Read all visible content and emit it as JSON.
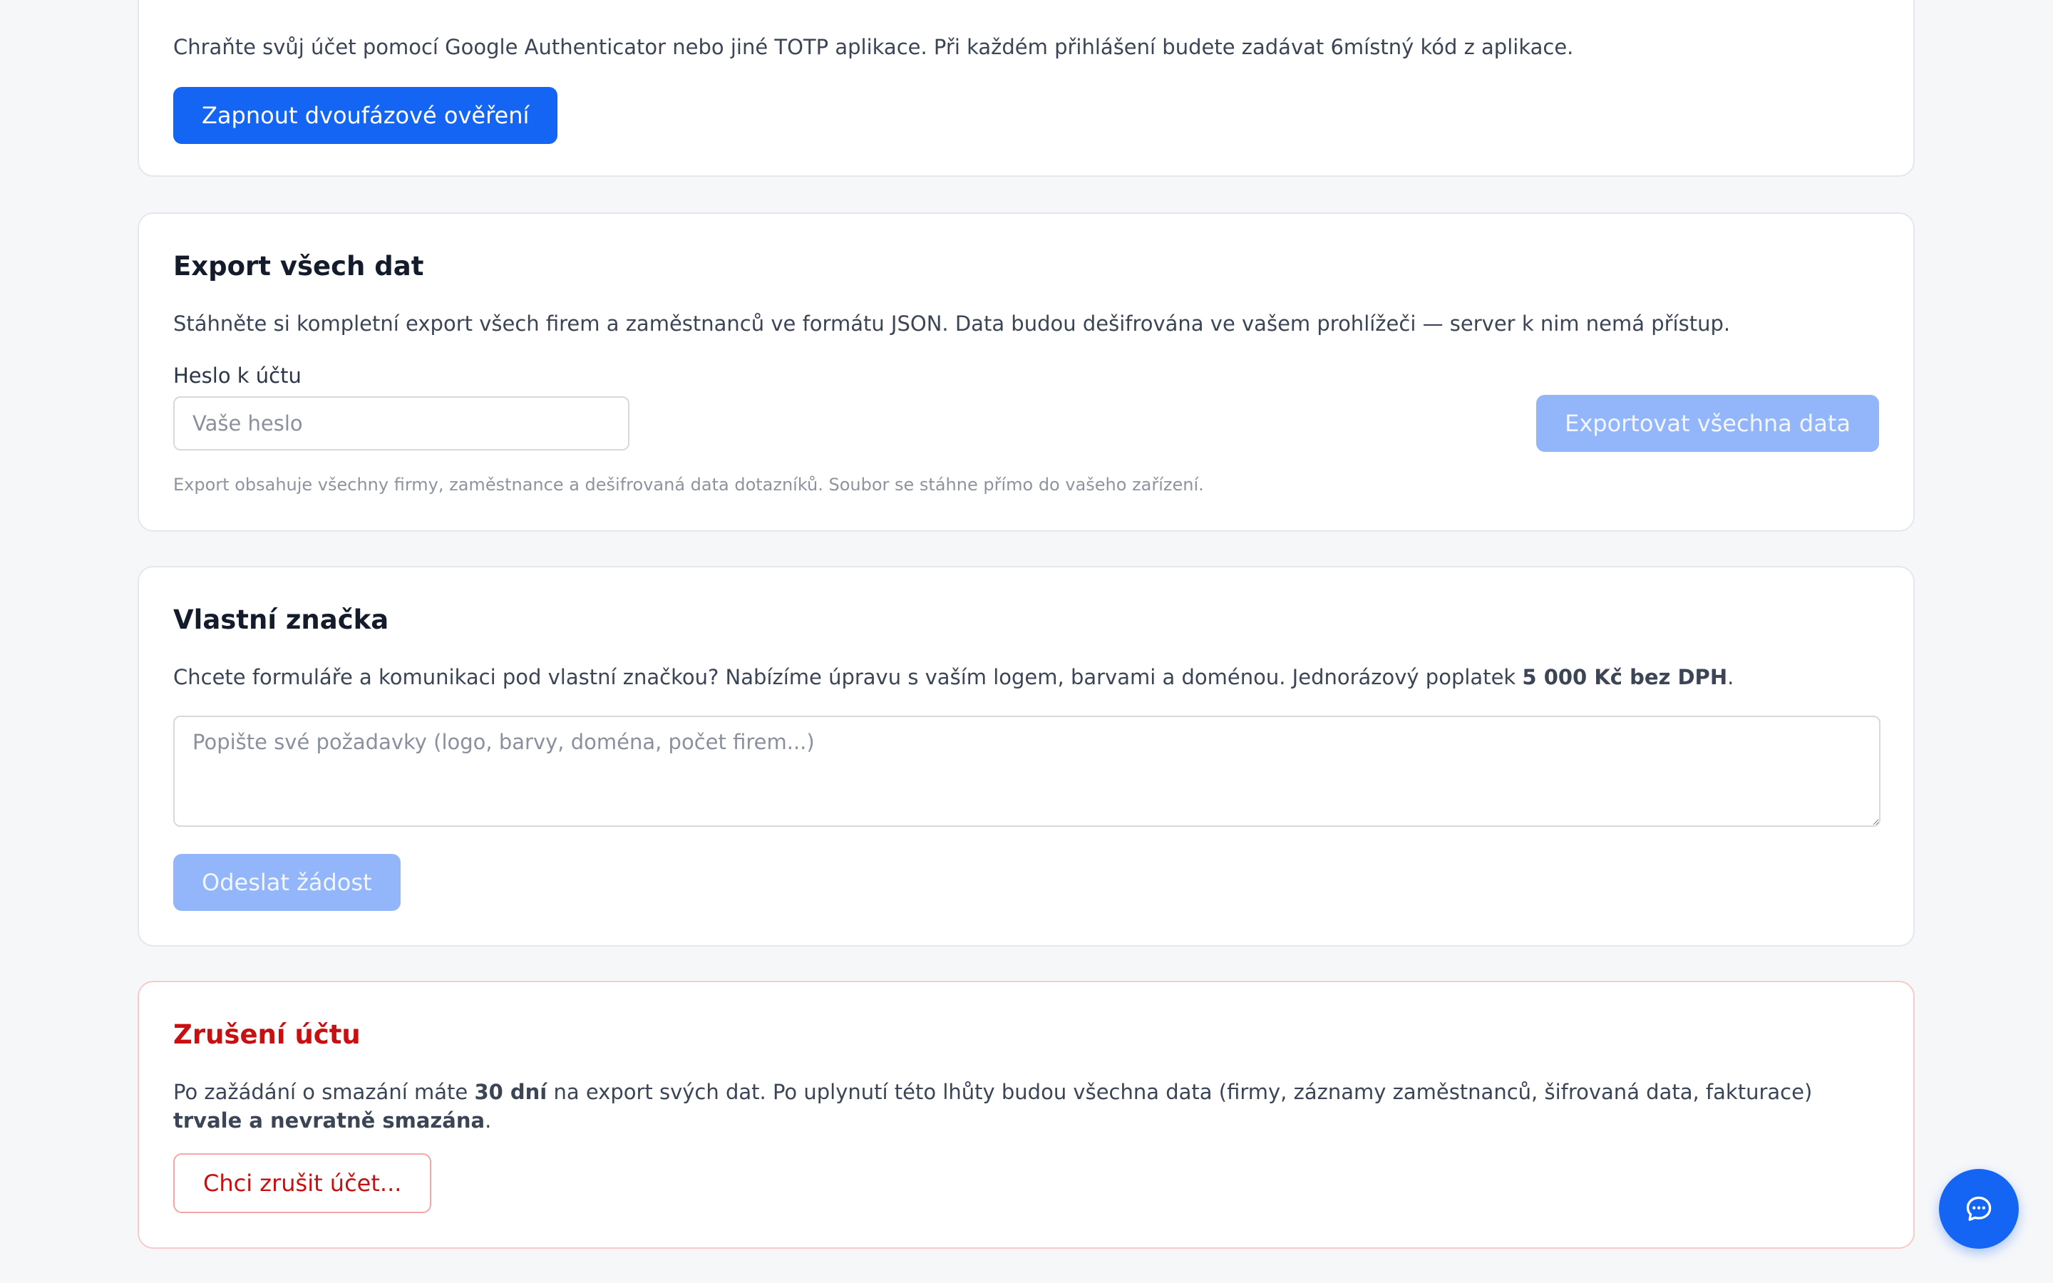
{
  "two_factor": {
    "description": "Chraňte svůj účet pomocí Google Authenticator nebo jiné TOTP aplikace. Při každém přihlášení budete zadávat 6místný kód z aplikace.",
    "button": "Zapnout dvoufázové ověření"
  },
  "export": {
    "title": "Export všech dat",
    "description": "Stáhněte si kompletní export všech firem a zaměstnanců ve formátu JSON. Data budou dešifrována ve vašem prohlížeči — server k nim nemá přístup.",
    "password_label": "Heslo k účtu",
    "password_value": "",
    "password_placeholder": "Vaše heslo",
    "button": "Exportovat všechna data",
    "hint": "Export obsahuje všechny firmy, zaměstnance a dešifrovaná data dotazníků. Soubor se stáhne přímo do vašeho zařízení."
  },
  "branding": {
    "title": "Vlastní značka",
    "description_prefix": "Chcete formuláře a komunikaci pod vlastní značkou? Nabízíme úpravu s vaším logem, barvami a doménou. Jednorázový poplatek ",
    "description_price": "5 000 Kč bez DPH",
    "description_suffix": ".",
    "request_value": "",
    "request_placeholder": "Popište své požadavky (logo, barvy, doména, počet firem...)",
    "button": "Odeslat žádost"
  },
  "deletion": {
    "title": "Zrušení účtu",
    "description_part1": "Po zažádání o smazání máte ",
    "description_days": "30 dní",
    "description_part2": " na export svých dat. Po uplynutí této lhůty budou všechna data (firmy, záznamy zaměstnanců, šifrovaná data, fakturace) ",
    "description_emphasis": "trvale a nevratně smazána",
    "description_part3": ".",
    "button": "Chci zrušit účet..."
  },
  "chat": {
    "icon": "chat-bubble-icon"
  },
  "colors": {
    "primary": "#1565f5",
    "primary_disabled": "#93b6fa",
    "danger": "#c90f0f",
    "danger_border": "#f4a7a7"
  }
}
